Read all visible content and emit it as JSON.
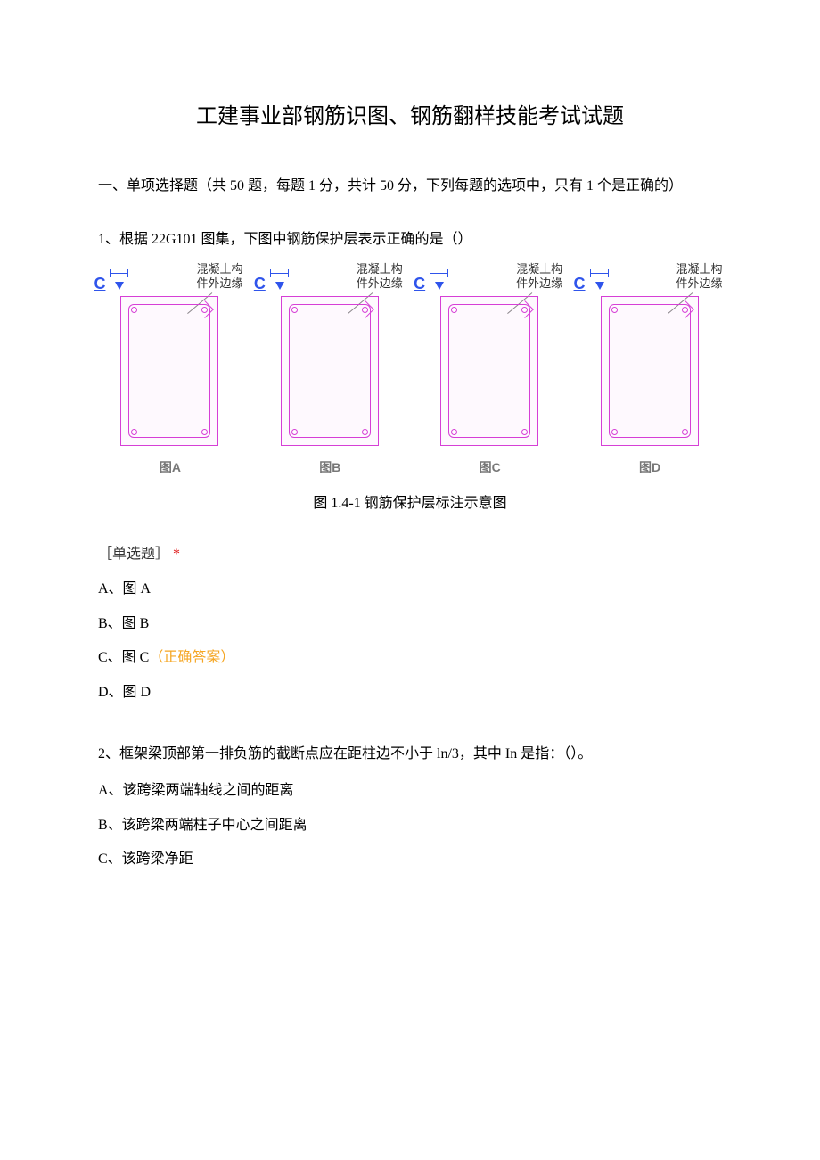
{
  "title": "工建事业部钢筋识图、钢筋翻样技能考试试题",
  "section_header": "一、单项选择题（共 50 题，每题 1 分，共计 50 分，下列每题的选项中，只有 1 个是正确的）",
  "q1": {
    "text": "1、根据 22G101 图集，下图中钢筋保护层表示正确的是（）",
    "diagrams": {
      "c_letter": "C",
      "edge_line1": "混凝土构",
      "edge_line2": "件外边缘",
      "labels": {
        "a": "图A",
        "b": "图B",
        "c": "图C",
        "d": "图D"
      }
    },
    "figure_caption": "图 1.4-1 钢筋保护层标注示意图",
    "tag_open": "［单选题］",
    "tag_star": "*",
    "options": {
      "a": "A、图 A",
      "b": "B、图 B",
      "c_prefix": "C、图 C",
      "c_correct": "（正确答案）",
      "d": "D、图 D"
    }
  },
  "q2": {
    "text": "2、框架梁顶部第一排负筋的截断点应在距柱边不小于 ln/3，其中 In 是指：（）。",
    "options": {
      "a": "A、该跨梁两端轴线之间的距离",
      "b": "B、该跨梁两端柱子中心之间距离",
      "c": "C、该跨梁净距"
    }
  }
}
